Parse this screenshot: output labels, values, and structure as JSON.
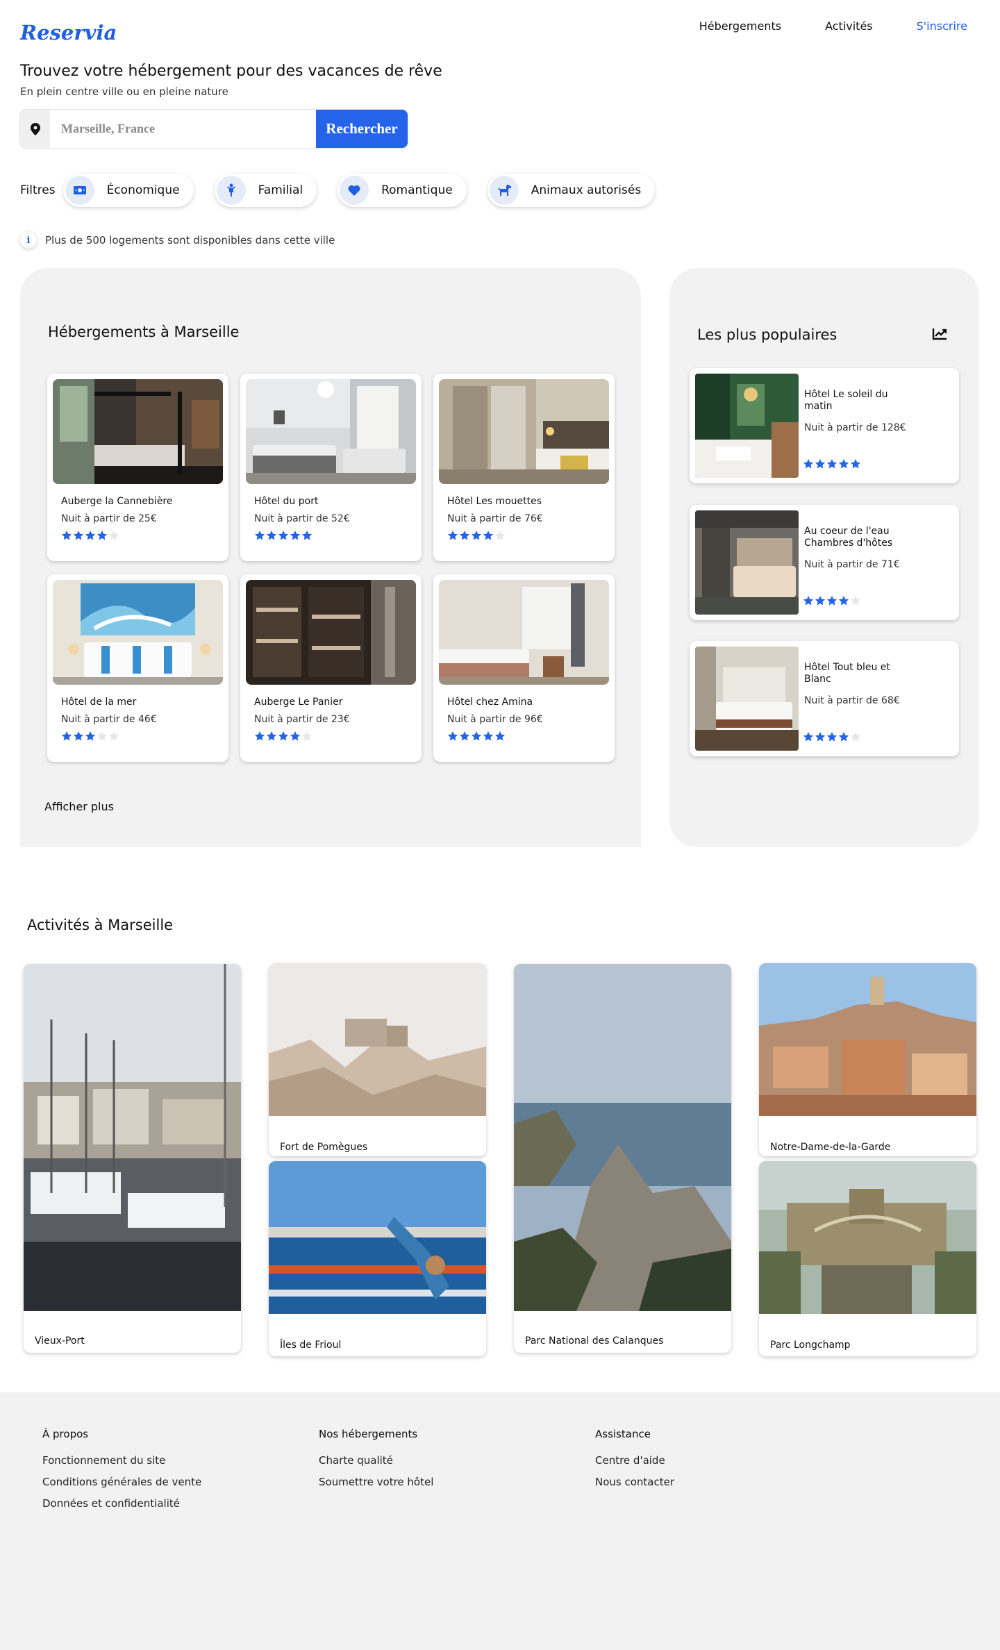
{
  "header": {
    "logo": "Reservia",
    "nav": [
      "Hébergements",
      "Activités",
      "S'inscrire"
    ]
  },
  "hero": {
    "title": "Trouvez votre hébergement pour des vacances de rêve",
    "subtitle": "En plein centre ville ou en pleine nature"
  },
  "search": {
    "placeholder": "Marseille, France",
    "button": "Rechercher",
    "icon": "location-pin-icon"
  },
  "filters": {
    "label": "Filtres",
    "items": [
      {
        "label": "Économique",
        "icon": "money-icon"
      },
      {
        "label": "Familial",
        "icon": "child-icon"
      },
      {
        "label": "Romantique",
        "icon": "heart-icon"
      },
      {
        "label": "Animaux autorisés",
        "icon": "dog-icon"
      }
    ]
  },
  "info": {
    "text": "Plus de 500 logements sont disponibles dans cette ville",
    "icon": "info-icon"
  },
  "lodging": {
    "title": "Hébergements à Marseille",
    "more": "Afficher plus",
    "cards": [
      {
        "name": "Auberge la Cannebière",
        "price": "Nuit à partir de 25€",
        "rating": 4
      },
      {
        "name": "Hôtel du port",
        "price": "Nuit à partir de 52€",
        "rating": 5
      },
      {
        "name": "Hôtel Les mouettes",
        "price": "Nuit à partir de 76€",
        "rating": 4
      },
      {
        "name": "Hôtel de la mer",
        "price": "Nuit à partir de 46€",
        "rating": 3
      },
      {
        "name": "Auberge Le Panier",
        "price": "Nuit à partir de 23€",
        "rating": 4
      },
      {
        "name": "Hôtel chez Amina",
        "price": "Nuit à partir de 96€",
        "rating": 5
      }
    ]
  },
  "popular": {
    "title": "Les plus populaires",
    "icon": "trending-chart-icon",
    "cards": [
      {
        "name": "Hôtel Le soleil du matin",
        "price": "Nuit à partir de 128€",
        "rating": 5
      },
      {
        "name": "Au coeur de l'eau Chambres d'hôtes",
        "price": "Nuit à partir de 71€",
        "rating": 4
      },
      {
        "name": "Hôtel Tout bleu et Blanc",
        "price": "Nuit à partir de 68€",
        "rating": 4
      }
    ]
  },
  "activities": {
    "title": "Activités à Marseille",
    "items": [
      "Vieux-Port",
      "Fort de Pomègues",
      "Îles de Frioul",
      "Parc National des Calanques",
      "Notre-Dame-de-la-Garde",
      "Parc Longchamp"
    ]
  },
  "footer": {
    "columns": [
      {
        "title": "À propos",
        "links": [
          "Fonctionnement du site",
          "Conditions générales de vente",
          "Données et confidentialité"
        ]
      },
      {
        "title": "Nos hébergements",
        "links": [
          "Charte qualité",
          "Soumettre votre hôtel"
        ]
      },
      {
        "title": "Assistance",
        "links": [
          "Centre d'aide",
          "Nous contacter"
        ]
      }
    ]
  },
  "colors": {
    "accent": "#2563eb",
    "panel": "#f2f2f2",
    "star_off": "#e6e6e6"
  }
}
